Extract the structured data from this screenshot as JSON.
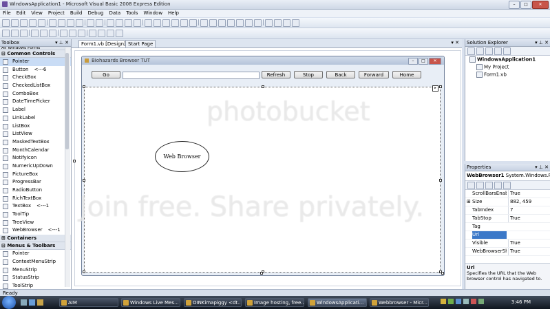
{
  "window": {
    "title": "WindowsApplication1 - Microsoft Visual Basic 2008 Express Edition"
  },
  "menu": [
    "File",
    "Edit",
    "View",
    "Project",
    "Build",
    "Debug",
    "Data",
    "Tools",
    "Window",
    "Help"
  ],
  "toolbox": {
    "title": "Toolbox",
    "top_item": "All Windows Forms",
    "categories": {
      "common": "Common Controls",
      "containers": "Containers",
      "menus": "Menus & Toolbars"
    },
    "common_items": [
      {
        "label": "Pointer",
        "note": ""
      },
      {
        "label": "Button",
        "note": "<---6"
      },
      {
        "label": "CheckBox",
        "note": ""
      },
      {
        "label": "CheckedListBox",
        "note": ""
      },
      {
        "label": "ComboBox",
        "note": ""
      },
      {
        "label": "DateTimePicker",
        "note": ""
      },
      {
        "label": "Label",
        "note": ""
      },
      {
        "label": "LinkLabel",
        "note": ""
      },
      {
        "label": "ListBox",
        "note": ""
      },
      {
        "label": "ListView",
        "note": ""
      },
      {
        "label": "MaskedTextBox",
        "note": ""
      },
      {
        "label": "MonthCalendar",
        "note": ""
      },
      {
        "label": "NotifyIcon",
        "note": ""
      },
      {
        "label": "NumericUpDown",
        "note": ""
      },
      {
        "label": "PictureBox",
        "note": ""
      },
      {
        "label": "ProgressBar",
        "note": ""
      },
      {
        "label": "RadioButton",
        "note": ""
      },
      {
        "label": "RichTextBox",
        "note": ""
      },
      {
        "label": "TextBox",
        "note": "<---1"
      },
      {
        "label": "ToolTip",
        "note": ""
      },
      {
        "label": "TreeView",
        "note": ""
      },
      {
        "label": "WebBrowser",
        "note": "<---1"
      }
    ],
    "menu_items": [
      "Pointer",
      "ContextMenuStrip",
      "MenuStrip",
      "StatusStrip",
      "ToolStrip"
    ]
  },
  "tabs": [
    "Form1.vb [Design]*",
    "Start Page"
  ],
  "form": {
    "title": "Biohazards Browser TUT",
    "buttons": {
      "go": "Go",
      "refresh": "Refresh",
      "stop": "Stop",
      "back": "Back",
      "forward": "Forward",
      "home": "Home"
    },
    "annotation": "Web Browser"
  },
  "solution_explorer": {
    "title": "Solution Explorer",
    "root": "WindowsApplication1",
    "children": [
      "My Project",
      "Form1.vb"
    ]
  },
  "properties": {
    "title": "Properties",
    "object": "WebBrowser1",
    "object_type": "System.Windows.Fo",
    "rows": [
      {
        "name": "ScrollBarsEnabled",
        "value": "True"
      },
      {
        "name": "Size",
        "value": "882, 459"
      },
      {
        "name": "TabIndex",
        "value": "7"
      },
      {
        "name": "TabStop",
        "value": "True"
      },
      {
        "name": "Tag",
        "value": ""
      },
      {
        "name": "Url",
        "value": ""
      },
      {
        "name": "Visible",
        "value": "True"
      },
      {
        "name": "WebBrowserShortcutsEnabled",
        "value": "True"
      }
    ],
    "desc_title": "Url",
    "desc_text": "Specifies the URL that the Web browser control has navigated to."
  },
  "watermark": {
    "logo": "photobucket",
    "tagline": "Join free. Share privately."
  },
  "status": "Ready",
  "taskbar": {
    "tasks": [
      {
        "label": "AIM",
        "active": false
      },
      {
        "label": "Windows Live Mes...",
        "active": false
      },
      {
        "label": "OINKimapiggy <dt...",
        "active": false
      },
      {
        "label": "Image hosting, free...",
        "active": false
      },
      {
        "label": "WindowsApplicati...",
        "active": true
      },
      {
        "label": "Webbrowser - Micr...",
        "active": false
      }
    ],
    "clock": "3:46 PM"
  }
}
